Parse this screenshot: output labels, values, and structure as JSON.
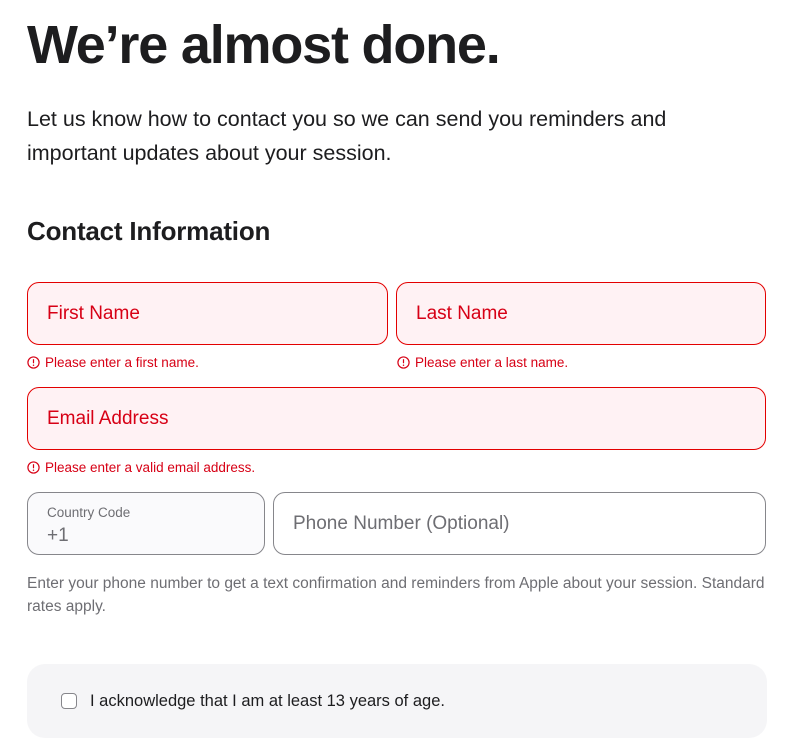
{
  "page": {
    "headline": "We’re almost done.",
    "intro": "Let us know how to contact you so we can send you reminders and important updates about your session."
  },
  "contact": {
    "section_title": "Contact Information",
    "first_name": {
      "placeholder": "First Name",
      "error": "Please enter a first name."
    },
    "last_name": {
      "placeholder": "Last Name",
      "error": "Please enter a last name."
    },
    "email": {
      "placeholder": "Email Address",
      "error": "Please enter a valid email address."
    },
    "country_code": {
      "label": "Country Code",
      "value": "+1"
    },
    "phone": {
      "placeholder": "Phone Number (Optional)"
    },
    "helper_text": "Enter your phone number to get a text confirmation and reminders from Apple about your session. Standard rates apply."
  },
  "acknowledgement": {
    "label": "I acknowledge that I am at least 13 years of age.",
    "checked": false
  },
  "colors": {
    "error": "#d70015",
    "error_bg": "#fff2f4",
    "text": "#1d1d1f",
    "secondary": "#6e6e73"
  },
  "icons": {
    "error": "exclamation-circle-icon"
  }
}
